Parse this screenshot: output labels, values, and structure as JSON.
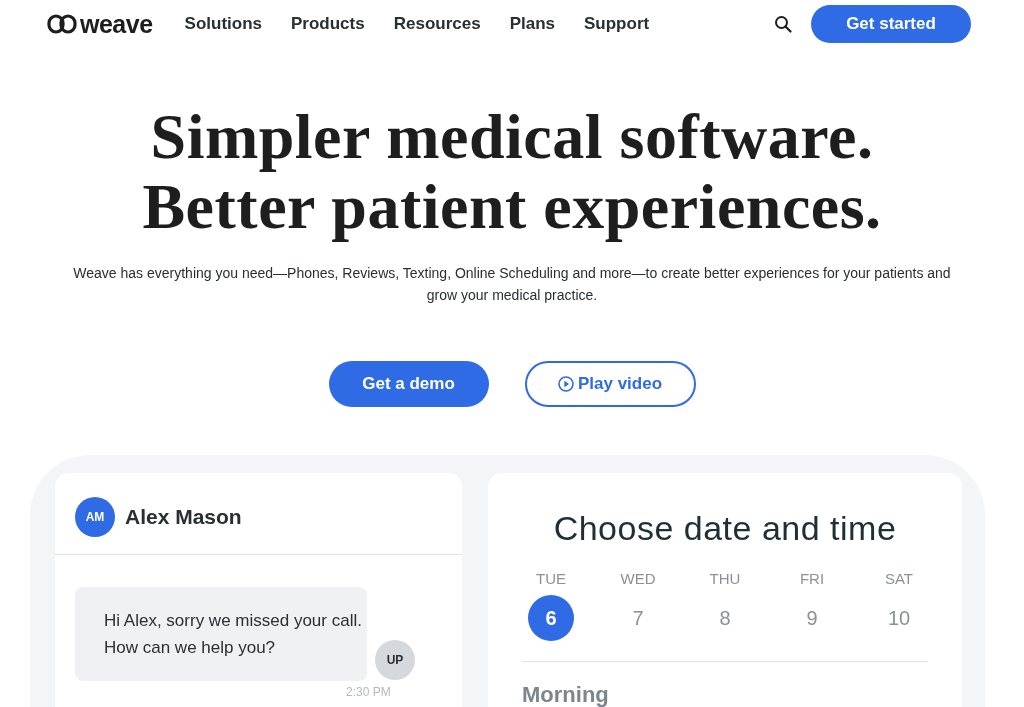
{
  "nav": {
    "logo": "weave",
    "links": [
      "Solutions",
      "Products",
      "Resources",
      "Plans",
      "Support"
    ],
    "cta": "Get started"
  },
  "hero": {
    "headline_lines": [
      "Simpler medical software.",
      "Better patient experiences."
    ],
    "subtitle": "Weave has everything you need—Phones, Reviews, Texting, Online Scheduling and more—to create better experiences for your patients and grow your medical practice.",
    "buttons": [
      {
        "label": "Get a demo",
        "kind": "primary"
      },
      {
        "label": "Play video",
        "kind": "video"
      }
    ]
  },
  "chat": {
    "avatar": "AM",
    "name": "Alex Mason",
    "messages": [
      {
        "text": "Hi Alex, sorry we missed your call. How can we help you?",
        "avatar": "UP",
        "time": "2:30 PM"
      }
    ]
  },
  "scheduler": {
    "title": "Choose date and time",
    "days": [
      {
        "weekday": "TUE",
        "date": "6",
        "selected": true
      },
      {
        "weekday": "WED",
        "date": "7",
        "selected": false
      },
      {
        "weekday": "THU",
        "date": "8",
        "selected": false
      },
      {
        "weekday": "FRI",
        "date": "9",
        "selected": false
      },
      {
        "weekday": "SAT",
        "date": "10",
        "selected": false
      }
    ],
    "section": "Morning"
  }
}
